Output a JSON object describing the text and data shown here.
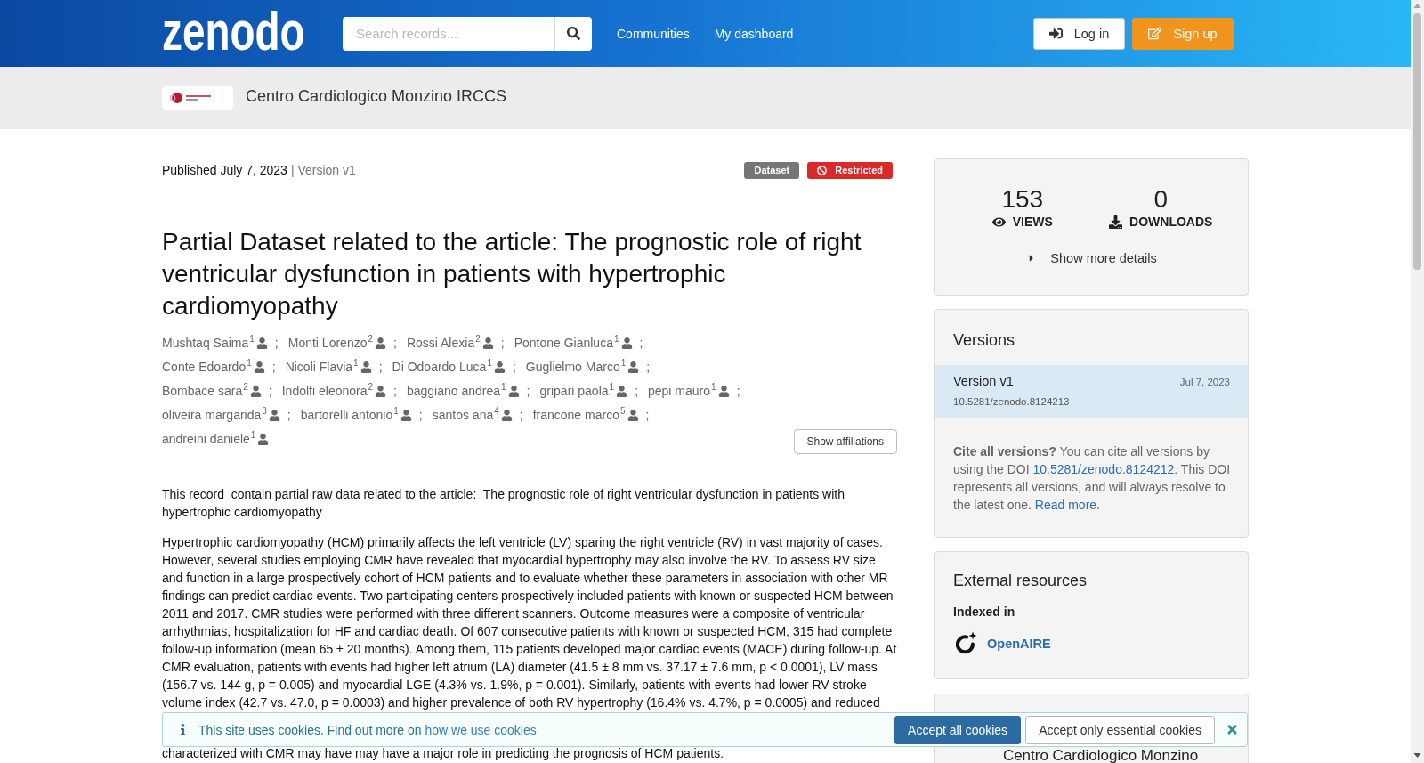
{
  "header": {
    "logo": "zenodo",
    "search": {
      "placeholder": "Search records..."
    },
    "nav": [
      "Communities",
      "My dashboard"
    ],
    "buttons": [
      {
        "label": "Log in",
        "kind": "login"
      },
      {
        "label": "Sign up",
        "kind": "signup"
      }
    ]
  },
  "community": {
    "name": "Centro Cardiologico Monzino IRCCS"
  },
  "record": {
    "published": "Published July 7, 2023",
    "version": "| Version v1",
    "badges": [
      {
        "label": "Dataset",
        "kind": "resource_type",
        "color": "#767676"
      },
      {
        "label": "Restricted",
        "kind": "access",
        "color": "#db2828"
      }
    ],
    "title": "Partial Dataset related to the article: The prognostic role of right ventricular dysfunction in patients with hypertrophic cardiomyopathy",
    "author_separator": ";",
    "authors": [
      {
        "name": "Mushtaq Saima",
        "affiliation": "1"
      },
      {
        "name": "Monti Lorenzo",
        "affiliation": "2"
      },
      {
        "name": "Rossi Alexia",
        "affiliation": "2"
      },
      {
        "name": "Pontone Gianluca",
        "affiliation": "1"
      },
      {
        "name": "Conte Edoardo",
        "affiliation": "1"
      },
      {
        "name": "Nicoli Flavia",
        "affiliation": "1"
      },
      {
        "name": "Di Odoardo Luca",
        "affiliation": "1"
      },
      {
        "name": "Guglielmo Marco",
        "affiliation": "1"
      },
      {
        "name": "Bombace sara",
        "affiliation": "2"
      },
      {
        "name": "Indolfi eleonora",
        "affiliation": "2"
      },
      {
        "name": "baggiano andrea",
        "affiliation": "1"
      },
      {
        "name": "gripari paola",
        "affiliation": "1"
      },
      {
        "name": "pepi mauro",
        "affiliation": "1"
      },
      {
        "name": "oliveira margarida",
        "affiliation": "3"
      },
      {
        "name": "bartorelli antonio",
        "affiliation": "1"
      },
      {
        "name": "santos ana",
        "affiliation": "4"
      },
      {
        "name": "francone marco",
        "affiliation": "5"
      },
      {
        "name": "andreini daniele",
        "affiliation": "1"
      }
    ],
    "affiliations_button": "Show affiliations",
    "description": {
      "paragraphs": [
        "This record  contain partial raw data related to the article:  The prognostic role of right ventricular dysfunction in patients with hypertrophic cardiomyopathy",
        "Hypertrophic cardiomyopathy (HCM) primarily affects the left ventricle (LV) sparing the right ventricle (RV) in vast majority of cases. However, several studies employing CMR have revealed that myocardial hypertrophy may also involve the RV. To assess RV size and function in a large prospectively cohort of HCM patients and to evaluate whether these parameters in association with other MR findings can predict cardiac events. Two participating centers prospectively included patients with known or suspected HCM between 2011 and 2017. CMR studies were performed with three different scanners. Outcome measures were a composite of ventricular arrhythmias, hospitalization for HF and cardiac death. Of 607 consecutive patients with known or suspected HCM, 315 had complete follow-up information (mean 65 ± 20 months). Among them, 115 patients developed major cardiac events (MACE) during follow-up. At CMR evaluation, patients with events had higher left atrium (LA) diameter (41.5 ± 8 mm vs. 37.17 ± 7.6 mm, p < 0.0001), LV mass (156.7 vs. 144 g, p = 0.005) and myocardial LGE (4.3% vs. 1.9%, p = 0.001). Similarly, patients with events had lower RV stroke volume index (42.7 vs. 47.0, p = 0.0003) and higher prevalence of both RV hypertrophy (16.4% vs. 4.7%, p = 0.0005) and reduced"
      ],
      "continuation": "characterized with CMR may have may have a major role in predicting the prognosis of HCM patients."
    }
  },
  "sidebar": {
    "stats": [
      {
        "value": "153",
        "label": "VIEWS",
        "kind": "views"
      },
      {
        "value": "0",
        "label": "DOWNLOADS",
        "kind": "downloads"
      }
    ],
    "details_toggle": {
      "label": "Show more details",
      "expanded": false
    },
    "versions": {
      "title": "Versions",
      "items": [
        {
          "label": "Version v1",
          "doi": "10.5281/zenodo.8124213",
          "date": "Jul 7, 2023",
          "selected": true
        }
      ],
      "cite": {
        "before_link": "**Cite all versions?** You can cite all versions by using the DOI",
        "doi_link": "10.5281/zenodo.8124212",
        "after_link": ". This DOI represents all versions, and will always resolve to the latest one.",
        "read_more": "Read more",
        "end": "."
      }
    },
    "external_resources": {
      "title": "External resources",
      "subtitle": "Indexed in",
      "links": [
        "OpenAIRE"
      ]
    },
    "community_card": {
      "name": "Centro Cardiologico Monzino"
    }
  },
  "cookie_banner": {
    "message": "This site uses cookies. Find out more on",
    "link": "how we use cookies",
    "buttons": [
      {
        "label": "Accept all cookies",
        "kind": "primary"
      },
      {
        "label": "Accept only essential cookies",
        "kind": "secondary"
      }
    ]
  }
}
